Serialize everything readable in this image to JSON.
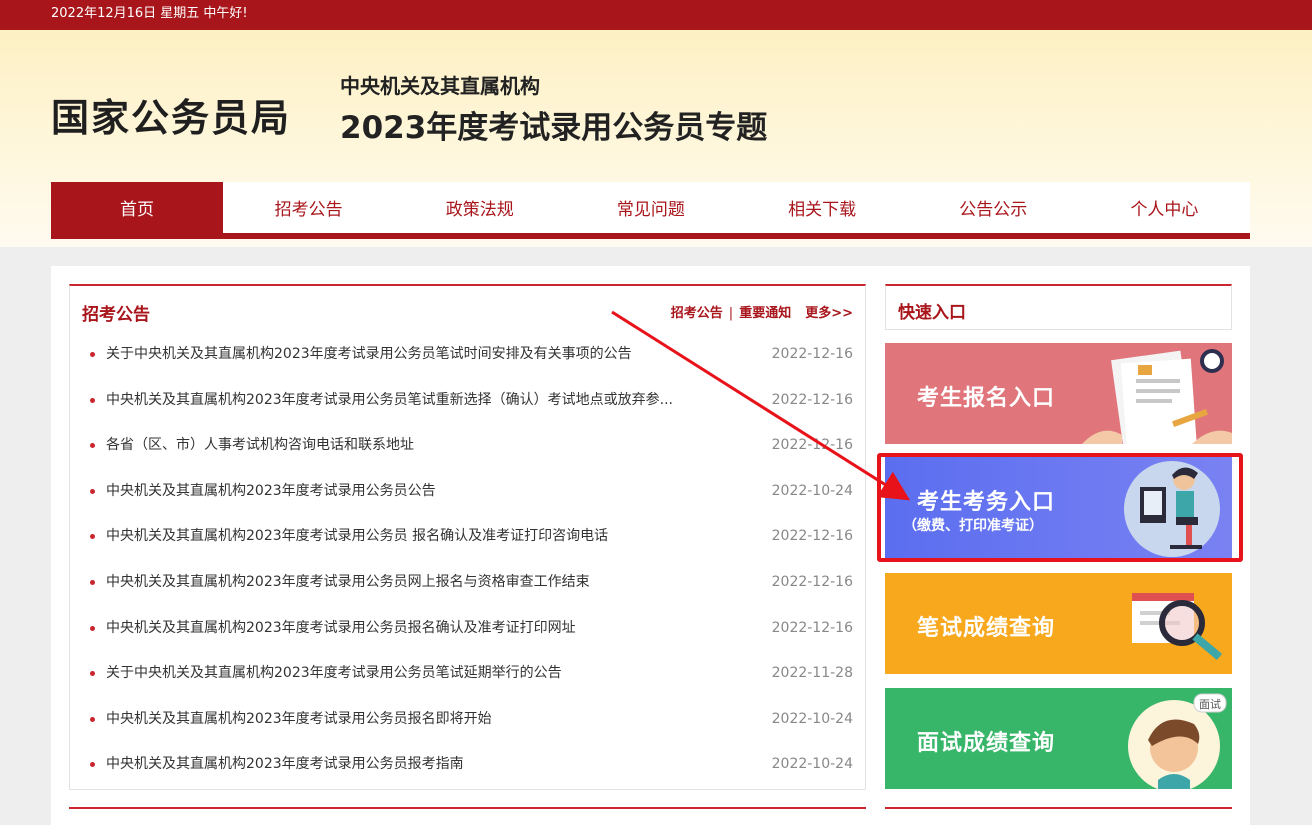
{
  "topbar": {
    "date_text": "2022年12月16日  星期五  中午好!"
  },
  "header": {
    "logo": "国家公务员局",
    "subtitle_line1": "中央机关及其直属机构",
    "subtitle_line2": "2023年度考试录用公务员专题"
  },
  "nav": {
    "items": [
      {
        "label": "首页"
      },
      {
        "label": "招考公告"
      },
      {
        "label": "政策法规"
      },
      {
        "label": "常见问题"
      },
      {
        "label": "相关下载"
      },
      {
        "label": "公告公示"
      },
      {
        "label": "个人中心"
      }
    ],
    "active_index": 0
  },
  "news_panel": {
    "title": "招考公告",
    "link_announcements": "招考公告",
    "separator": "|",
    "link_important": "重要通知",
    "link_more": "更多>>",
    "items": [
      {
        "title": "关于中央机关及其直属机构2023年度考试录用公务员笔试时间安排及有关事项的公告",
        "date": "2022-12-16"
      },
      {
        "title": "中央机关及其直属机构2023年度考试录用公务员笔试重新选择（确认）考试地点或放弃参...",
        "date": "2022-12-16"
      },
      {
        "title": "各省（区、市）人事考试机构咨询电话和联系地址",
        "date": "2022-12-16"
      },
      {
        "title": "中央机关及其直属机构2023年度考试录用公务员公告",
        "date": "2022-10-24"
      },
      {
        "title": "中央机关及其直属机构2023年度考试录用公务员 报名确认及准考证打印咨询电话",
        "date": "2022-12-16"
      },
      {
        "title": "中央机关及其直属机构2023年度考试录用公务员网上报名与资格审查工作结束",
        "date": "2022-12-16"
      },
      {
        "title": "中央机关及其直属机构2023年度考试录用公务员报名确认及准考证打印网址",
        "date": "2022-12-16"
      },
      {
        "title": "关于中央机关及其直属机构2023年度考试录用公务员笔试延期举行的公告",
        "date": "2022-11-28"
      },
      {
        "title": "中央机关及其直属机构2023年度考试录用公务员报名即将开始",
        "date": "2022-10-24"
      },
      {
        "title": "中央机关及其直属机构2023年度考试录用公务员报考指南",
        "date": "2022-10-24"
      }
    ]
  },
  "quick_entry": {
    "title": "快速入口",
    "banners": [
      {
        "label": "考生报名入口",
        "color": "#e0767b"
      },
      {
        "label": "考生考务入口",
        "sub": "（缴费、打印准考证）",
        "color": "#5b6ef0"
      },
      {
        "label": "笔试成绩查询",
        "color": "#f8a81c"
      },
      {
        "label": "面试成绩查询",
        "color": "#37b66a"
      }
    ]
  },
  "annotation": {
    "highlight_color": "#e8121a"
  }
}
